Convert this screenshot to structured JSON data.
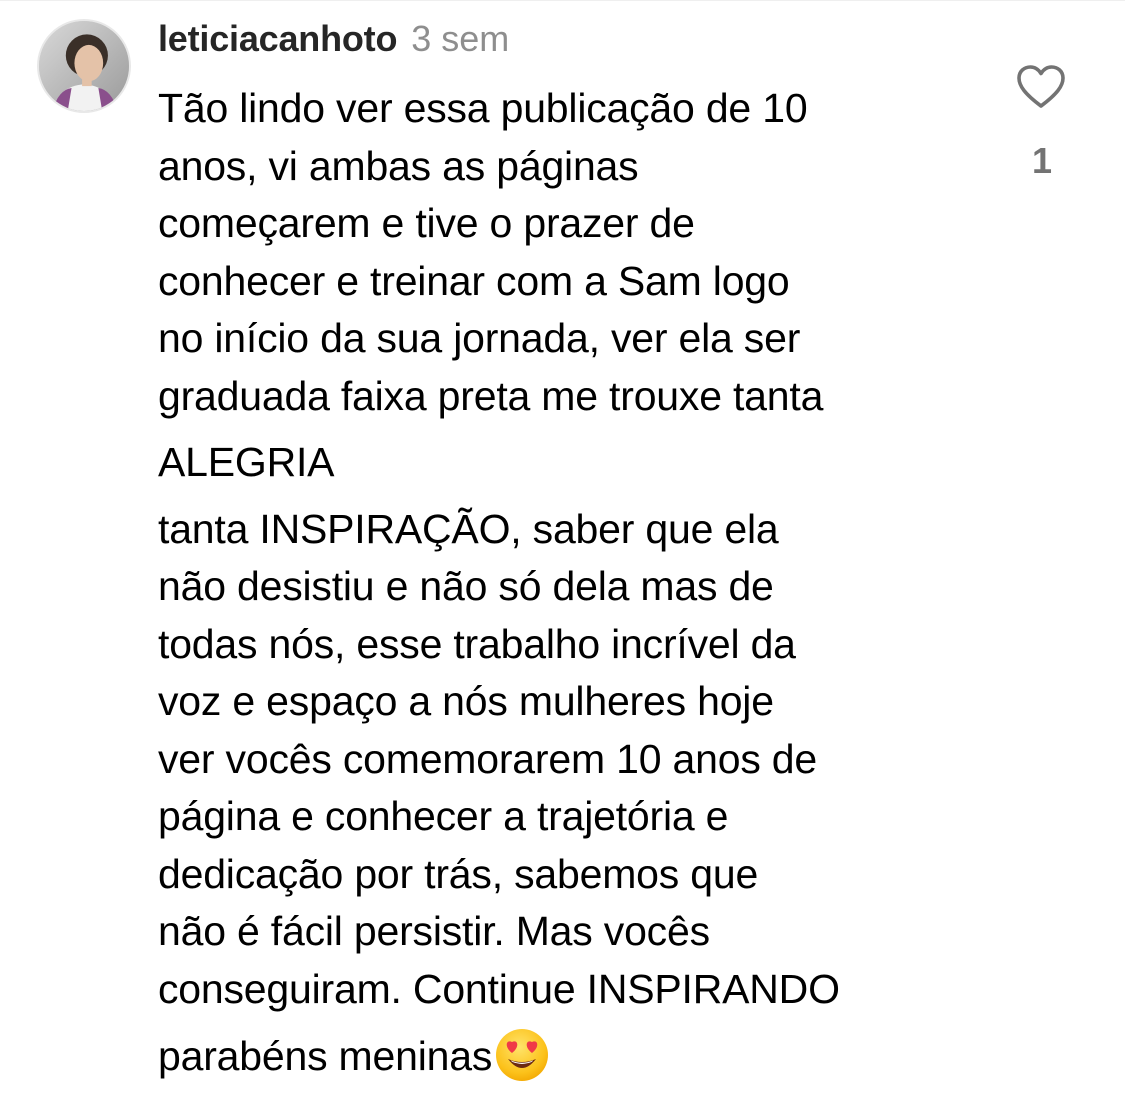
{
  "comment": {
    "author": {
      "username": "leticiacanhoto",
      "avatar_icon": "profile-photo"
    },
    "timestamp": "3 sem",
    "body": {
      "intro": "Tão lindo ver essa publicação de 10\nanos, vi ambas as páginas\ncomeçarem e tive o prazer de\nconhecer e treinar com a Sam logo\nno início da sua jornada, ver ela ser\ngraduada faixa preta me trouxe tanta",
      "highlight": "ALEGRIA",
      "continuation": "tanta INSPIRAÇÃO, saber que ela\nnão desistiu e não só dela mas de\ntodas nós, esse trabalho incrível da\nvoz e espaço a nós mulheres hoje\nver vocês comemorarem 10 anos de\npágina e conhecer a trajetória e\ndedicação por trás, sabemos que\nnão é fácil persistir. Mas vocês\nconseguiram. Continue INSPIRANDO",
      "closing": "parabéns meninas",
      "closing_emoji": "heart-eyes-emoji"
    },
    "likes": {
      "icon": "heart-outline-icon",
      "count": "1"
    }
  },
  "colors": {
    "username": "#262626",
    "timestamp": "#8e8e8e",
    "body_text": "#000000",
    "like_count": "#737373"
  }
}
